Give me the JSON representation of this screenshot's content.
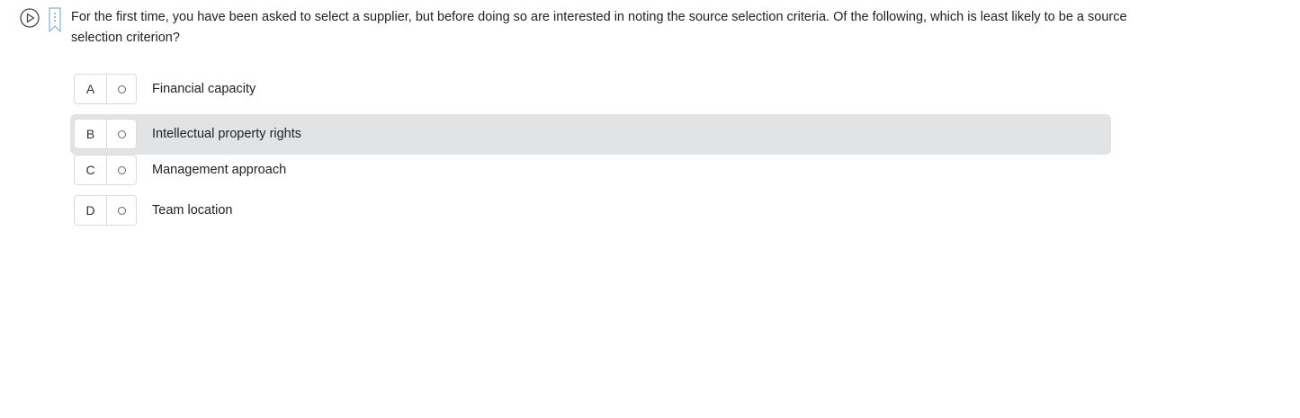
{
  "question": {
    "text": "For the first time, you have been asked to select a supplier, but before doing so are interested in noting the source selection criteria. Of the following, which is least likely to be a source selection criterion?"
  },
  "icons": {
    "play": "play-circle-icon",
    "bookmark": "bookmark-icon"
  },
  "options": [
    {
      "letter": "A",
      "label": "Financial capacity"
    },
    {
      "letter": "B",
      "label": "Intellectual property rights"
    },
    {
      "letter": "C",
      "label": "Management approach"
    },
    {
      "letter": "D",
      "label": "Team location"
    }
  ],
  "colors": {
    "hover_background": "#e2e3e5",
    "border": "#dcdcdc",
    "bookmark_accent": "#4a90c2"
  }
}
